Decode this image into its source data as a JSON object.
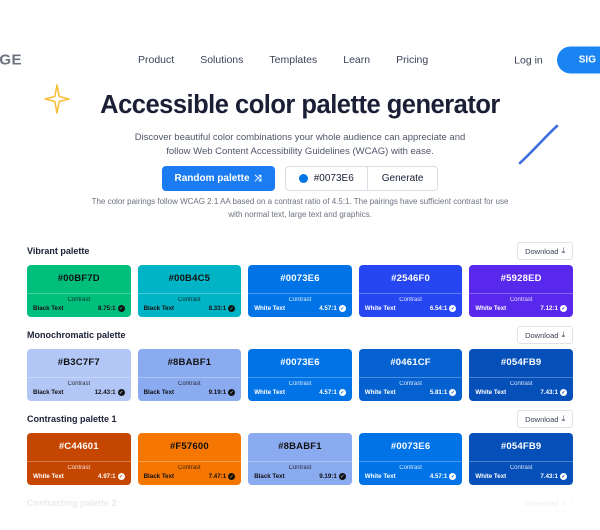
{
  "header": {
    "logo": "AGE",
    "nav": [
      {
        "label": "Product"
      },
      {
        "label": "Solutions"
      },
      {
        "label": "Templates"
      },
      {
        "label": "Learn"
      },
      {
        "label": "Pricing"
      }
    ],
    "login_label": "Log in",
    "signup_label": "SIG"
  },
  "hero": {
    "title": "Accessible color palette generator",
    "subtitle": "Discover beautiful color combinations your whole audience can appreciate and follow Web Content Accessibility Guidelines (WCAG) with ease."
  },
  "controls": {
    "random_label": "Random palette",
    "shuffle_icon": "⤨",
    "hex_value": "#0073E6",
    "hex_placeholder": "#0073E6",
    "swatch_color": "#0073E6",
    "generate_label": "Generate"
  },
  "note": "The color pairings follow WCAG 2.1 AA based on a contrast ratio of 4.5:1. The pairings have sufficient contrast for use with normal text, large text and graphics.",
  "download_label": "Download",
  "download_icon": "⤓",
  "contrast_label": "Contrast",
  "palettes": [
    {
      "title": "Vibrant palette",
      "cards": [
        {
          "hex": "#00BF7D",
          "bg": "#00BF7D",
          "text_mode": "Black Text",
          "fg": "#111111",
          "ratio": "8.75:1",
          "badge_bg": "#111111",
          "badge_fg": "#00BF7D"
        },
        {
          "hex": "#00B4C5",
          "bg": "#00B4C5",
          "text_mode": "Black Text",
          "fg": "#111111",
          "ratio": "8.33:1",
          "badge_bg": "#111111",
          "badge_fg": "#00B4C5"
        },
        {
          "hex": "#0073E6",
          "bg": "#0073E6",
          "text_mode": "White Text",
          "fg": "#ffffff",
          "ratio": "4.57:1",
          "badge_bg": "#ffffff",
          "badge_fg": "#0073E6"
        },
        {
          "hex": "#2546F0",
          "bg": "#2546F0",
          "text_mode": "White Text",
          "fg": "#ffffff",
          "ratio": "6.54:1",
          "badge_bg": "#ffffff",
          "badge_fg": "#2546F0"
        },
        {
          "hex": "#5928ED",
          "bg": "#5928ED",
          "text_mode": "White Text",
          "fg": "#ffffff",
          "ratio": "7.12:1",
          "badge_bg": "#ffffff",
          "badge_fg": "#5928ED"
        }
      ]
    },
    {
      "title": "Monochromatic palette",
      "cards": [
        {
          "hex": "#B3C7F7",
          "bg": "#B3C7F7",
          "text_mode": "Black Text",
          "fg": "#111111",
          "ratio": "12.43:1",
          "badge_bg": "#111111",
          "badge_fg": "#B3C7F7"
        },
        {
          "hex": "#8BABF1",
          "bg": "#8BABF1",
          "text_mode": "Black Text",
          "fg": "#111111",
          "ratio": "9.19:1",
          "badge_bg": "#111111",
          "badge_fg": "#8BABF1"
        },
        {
          "hex": "#0073E6",
          "bg": "#0073E6",
          "text_mode": "White Text",
          "fg": "#ffffff",
          "ratio": "4.57:1",
          "badge_bg": "#ffffff",
          "badge_fg": "#0073E6"
        },
        {
          "hex": "#0461CF",
          "bg": "#0461CF",
          "text_mode": "White Text",
          "fg": "#ffffff",
          "ratio": "5.81:1",
          "badge_bg": "#ffffff",
          "badge_fg": "#0461CF"
        },
        {
          "hex": "#054FB9",
          "bg": "#054FB9",
          "text_mode": "White Text",
          "fg": "#ffffff",
          "ratio": "7.43:1",
          "badge_bg": "#ffffff",
          "badge_fg": "#054FB9"
        }
      ]
    },
    {
      "title": "Contrasting palette 1",
      "cards": [
        {
          "hex": "#C44601",
          "bg": "#C44601",
          "text_mode": "White Text",
          "fg": "#ffffff",
          "ratio": "4.97:1",
          "badge_bg": "#ffffff",
          "badge_fg": "#C44601"
        },
        {
          "hex": "#F57600",
          "bg": "#F57600",
          "text_mode": "Black Text",
          "fg": "#111111",
          "ratio": "7.47:1",
          "badge_bg": "#111111",
          "badge_fg": "#F57600"
        },
        {
          "hex": "#8BABF1",
          "bg": "#8BABF1",
          "text_mode": "Black Text",
          "fg": "#111111",
          "ratio": "9.19:1",
          "badge_bg": "#111111",
          "badge_fg": "#8BABF1"
        },
        {
          "hex": "#0073E6",
          "bg": "#0073E6",
          "text_mode": "White Text",
          "fg": "#ffffff",
          "ratio": "4.57:1",
          "badge_bg": "#ffffff",
          "badge_fg": "#0073E6"
        },
        {
          "hex": "#054FB9",
          "bg": "#054FB9",
          "text_mode": "White Text",
          "fg": "#ffffff",
          "ratio": "7.43:1",
          "badge_bg": "#ffffff",
          "badge_fg": "#054FB9"
        }
      ]
    },
    {
      "title": "Contrasting palette 2",
      "cut_off": true,
      "cards": []
    }
  ]
}
